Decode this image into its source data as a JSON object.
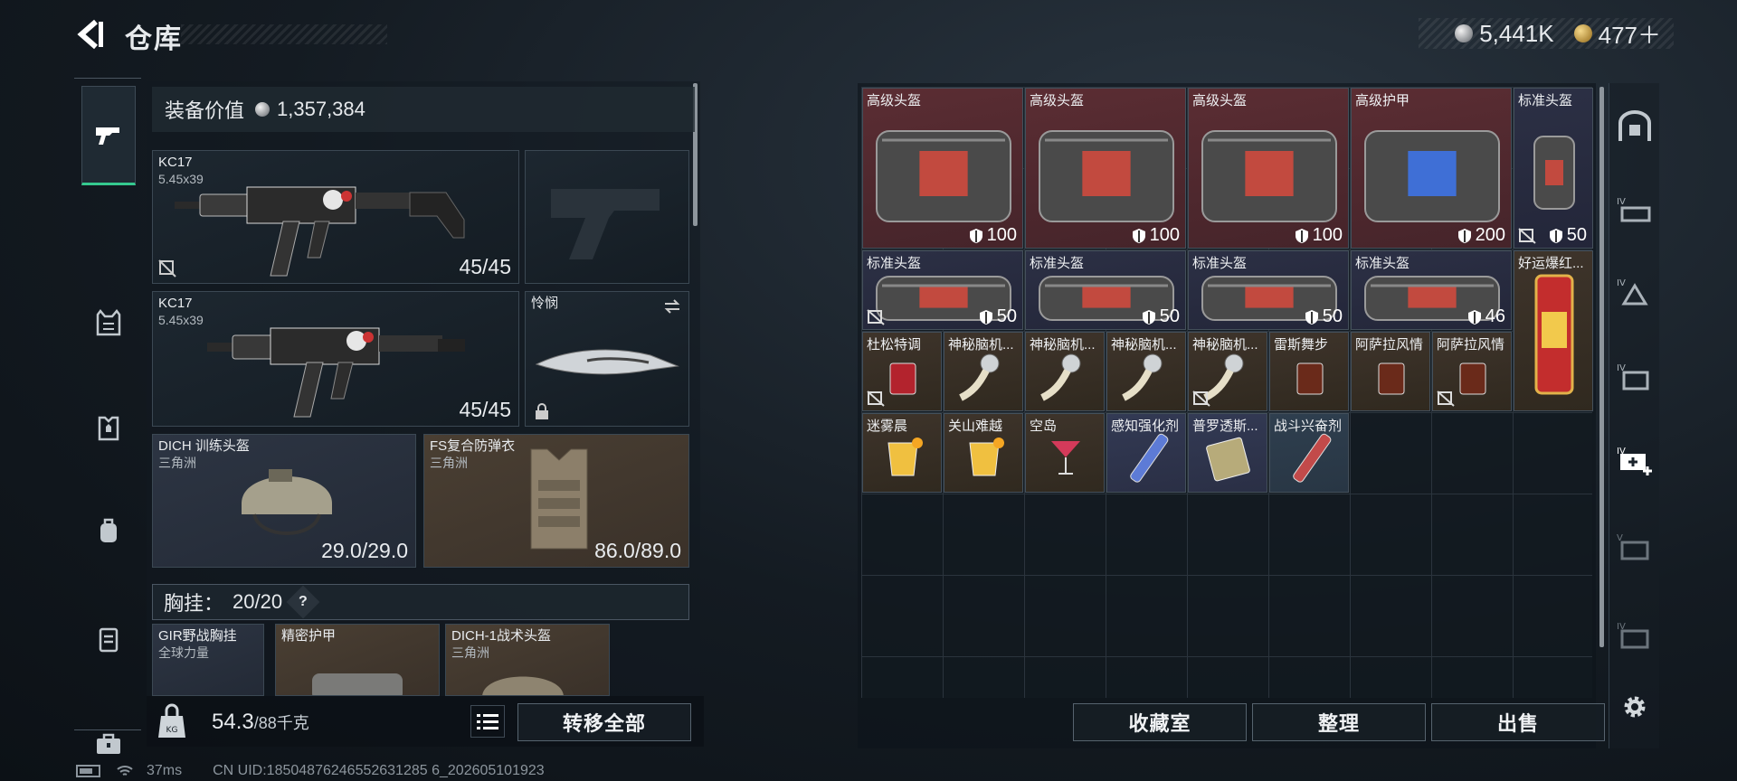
{
  "header": {
    "title": "仓库"
  },
  "currency": [
    {
      "name": "silver-coin",
      "value": "5,441K"
    },
    {
      "name": "gold-coin",
      "value": "477＋"
    }
  ],
  "equipment": {
    "label": "装备价值",
    "value": "1,357,384"
  },
  "weapons": [
    {
      "name": "KC17",
      "caliber": "5.45x39",
      "ammo": "45/45"
    },
    {
      "name": "KC17",
      "caliber": "5.45x39",
      "ammo": "45/45"
    }
  ],
  "melee": {
    "name": "怜悯"
  },
  "helmet": {
    "name": "DICH 训练头盔",
    "origin": "三角洲",
    "durability": "29.0/29.0"
  },
  "armor": {
    "name": "FS复合防弹衣",
    "origin": "三角洲",
    "durability": "86.0/89.0"
  },
  "chest": {
    "label": "胸挂：",
    "value": "20/20",
    "help": "?"
  },
  "chest_items": [
    {
      "name": "GIR野战胸挂",
      "sub": "全球力量"
    },
    {
      "name": "精密护甲",
      "sub": ""
    },
    {
      "name": "DICH-1战术头盔",
      "sub": "三角洲"
    }
  ],
  "weight": {
    "value": "54.3",
    "capacity": "/88千克"
  },
  "buttons": {
    "transfer_all": "转移全部",
    "collection": "收藏室",
    "organize": "整理",
    "sell": "出售"
  },
  "stash": [
    {
      "label": "高级头盔",
      "durability": "100",
      "bg": "red"
    },
    {
      "label": "高级头盔",
      "durability": "100",
      "bg": "red"
    },
    {
      "label": "高级头盔",
      "durability": "100",
      "bg": "red"
    },
    {
      "label": "高级护甲",
      "durability": "200",
      "bg": "red"
    },
    {
      "label": "标准头盔",
      "durability": "50",
      "bg": "navy"
    },
    {
      "label": "标准头盔",
      "durability": "50",
      "bg": "navy"
    },
    {
      "label": "标准头盔",
      "durability": "50",
      "bg": "navy"
    },
    {
      "label": "标准头盔",
      "durability": "50",
      "bg": "navy"
    },
    {
      "label": "标准头盔",
      "durability": "46",
      "bg": "navy"
    },
    {
      "label": "好运爆红...",
      "bg": "brown"
    },
    {
      "label": "杜松特调",
      "bg": "brown"
    },
    {
      "label": "神秘脑机...",
      "bg": "brown"
    },
    {
      "label": "神秘脑机...",
      "bg": "brown"
    },
    {
      "label": "神秘脑机...",
      "bg": "brown"
    },
    {
      "label": "神秘脑机...",
      "bg": "brown"
    },
    {
      "label": "雷斯舞步",
      "bg": "brown"
    },
    {
      "label": "阿萨拉风情",
      "bg": "brown"
    },
    {
      "label": "阿萨拉风情",
      "bg": "brown"
    },
    {
      "label": "迷雾晨",
      "bg": "brown"
    },
    {
      "label": "关山难越",
      "bg": "brown"
    },
    {
      "label": "空岛",
      "bg": "brown"
    },
    {
      "label": "感知强化剂",
      "bg": "lightnavy"
    },
    {
      "label": "普罗透斯...",
      "bg": "lightnavy"
    },
    {
      "label": "战斗兴奋剂",
      "bg": "teal"
    }
  ],
  "status": {
    "ping": "37ms",
    "uid": "CN UID:18504876246552631285 6_202605101923"
  }
}
